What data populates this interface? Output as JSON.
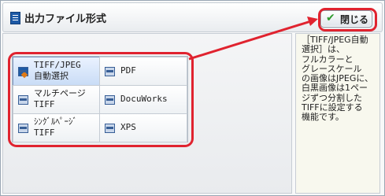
{
  "dialog": {
    "title": "出力ファイル形式",
    "close_label": "閉じる"
  },
  "options": [
    {
      "label_line1": "TIFF/JPEG",
      "label_line2": "自動選択",
      "icon": "tiff-jpeg-icon",
      "selected": true
    },
    {
      "label_line1": "PDF",
      "label_line2": "",
      "icon": "pdf-icon",
      "selected": false
    },
    {
      "label_line1": "マルチページ",
      "label_line2": "TIFF",
      "icon": "tiff-icon",
      "selected": false
    },
    {
      "label_line1": "DocuWorks",
      "label_line2": "",
      "icon": "docuworks-icon",
      "selected": false
    },
    {
      "label_line1": "ｼﾝｸﾞﾙﾍﾟｰｼﾞ",
      "label_line2": "TIFF",
      "icon": "tiff-icon",
      "selected": false
    },
    {
      "label_line1": "XPS",
      "label_line2": "",
      "icon": "xps-icon",
      "selected": false
    }
  ],
  "description": "［TIFF/JPEG自動\n選択］は、\nフルカラーと\nグレースケール\nの画像はJPEGに、\n白黒画像は1ペー\nジずつ分割した\nTIFFに設定する\n機能です。",
  "colors": {
    "annotation": "#e0232f",
    "selected_option": "#c9dcf6",
    "accent": "#1d5aa6"
  }
}
